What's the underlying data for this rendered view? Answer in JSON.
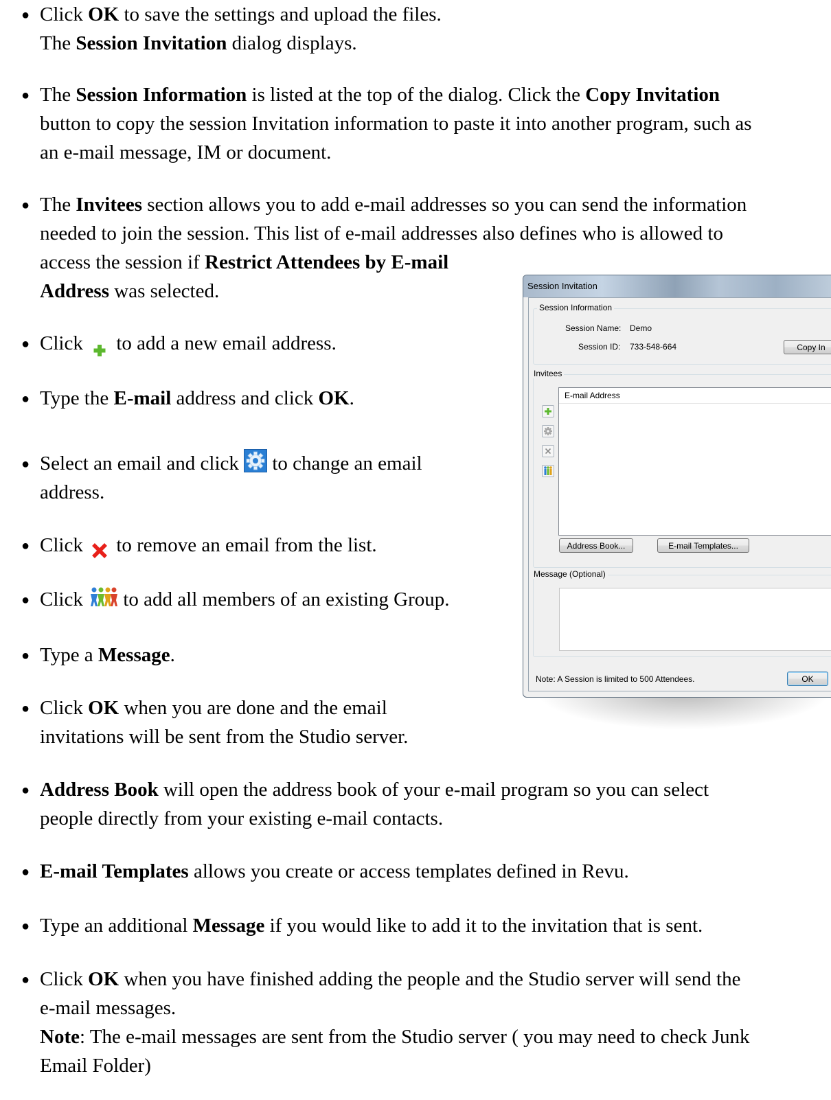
{
  "bullets": {
    "b1": {
      "pre": "Click ",
      "ok": "OK",
      "post": " to save the settings and upload the files.",
      "l2_pre": "The ",
      "l2_bold": "Session Invitation",
      "l2_post": " dialog displays."
    },
    "b2": {
      "pre": "The ",
      "bold1": "Session Information",
      "mid": " is listed at the top of the dialog. Click the ",
      "bold2": "Copy Invitation",
      "l2": "button to copy the session Invitation information to paste it into another program, such as",
      "l3": "an e-mail message, IM or document."
    },
    "b3": {
      "pre": "The ",
      "bold1": "Invitees",
      "post": " section allows you to add e-mail addresses so you can send the information",
      "l2": "needed to join the session. This list of e-mail addresses also defines who is allowed to",
      "l3_pre": "access the session if ",
      "l3_bold": "Restrict Attendees by E-mail",
      "l4_bold": "Address",
      "l4_post": " was selected."
    },
    "b4": {
      "pre": "Click ",
      "post": " to add a new email address."
    },
    "b5": {
      "pre": "Type the ",
      "bold1": "E-mail",
      "mid": " address and click ",
      "bold2": "OK",
      "post": "."
    },
    "b6": {
      "pre": "Select an email and click ",
      "post": " to change an email",
      "l2": "address."
    },
    "b7": {
      "pre": "Click ",
      "post": " to remove an email from the list."
    },
    "b8": {
      "pre": "Click ",
      "post": " to add all members of an existing Group."
    },
    "b9": {
      "pre": "Type a ",
      "bold1": "Message",
      "post": "."
    },
    "b10": {
      "pre": "Click ",
      "bold1": "OK",
      "post": " when you are done and the email",
      "l2": "invitations will be sent from the Studio server."
    },
    "b11": {
      "bold1": "Address Book",
      "post": " will open the address book of your e-mail program so you can select",
      "l2": "people directly from your existing e-mail contacts."
    },
    "b12": {
      "bold1": "E-mail Templates",
      "post": " allows you create or access templates defined in Revu."
    },
    "b13": {
      "pre": "Type an additional ",
      "bold1": "Message",
      "post": " if you would like to add it to the invitation that is sent."
    },
    "b14": {
      "pre": "Click ",
      "bold1": "OK",
      "post": " when you have finished adding the people and the Studio server will send the",
      "l2": "e-mail messages.",
      "l3_bold": "Note",
      "l3_post": ": The e-mail messages are sent from the Studio server ( you may need to check Junk",
      "l4": "Email Folder)"
    }
  },
  "icons": {
    "add": "plus-icon",
    "settings": "gear-icon",
    "remove": "red-x-icon",
    "group": "group-icon"
  },
  "colors": {
    "add_icon": "#5cb82e",
    "remove_icon": "#e8201a",
    "gear_bg": "#2a7fd4"
  },
  "dialog": {
    "title": "Session Invitation",
    "session_info_label": "Session Information",
    "session_name_label": "Session Name:",
    "session_name_value": "Demo",
    "session_id_label": "Session ID:",
    "session_id_value": "733-548-664",
    "copy_button": "Copy In",
    "invitees_label": "Invitees",
    "column_header": "E-mail Address",
    "address_book_button": "Address Book...",
    "templates_button": "E-mail Templates...",
    "message_label": "Message (Optional)",
    "note": "Note: A Session is limited to 500 Attendees.",
    "ok_button": "OK"
  }
}
